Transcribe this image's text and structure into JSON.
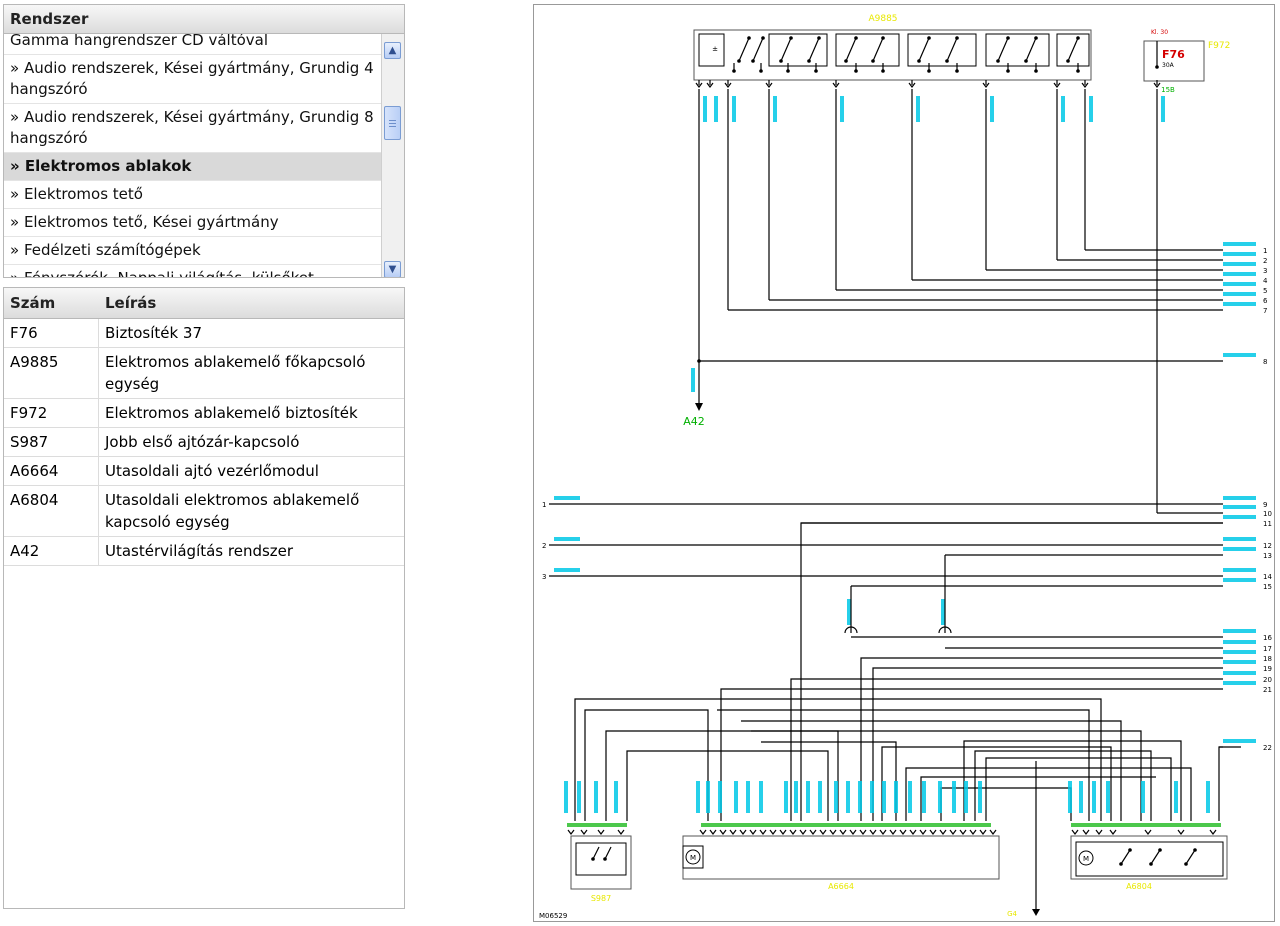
{
  "system_panel": {
    "header": "Rendszer",
    "items": [
      {
        "label": "Gamma hangrendszer CD váltóval",
        "active": false
      },
      {
        "label": "» Audio rendszerek, Kései gyártmány, Grundig 4 hangszóró",
        "active": false
      },
      {
        "label": "» Audio rendszerek, Kései gyártmány, Grundig 8 hangszóró",
        "active": false
      },
      {
        "label": "» Elektromos ablakok",
        "active": true
      },
      {
        "label": "» Elektromos tető",
        "active": false
      },
      {
        "label": "» Elektromos tető, Kései gyártmány",
        "active": false
      },
      {
        "label": "» Fedélzeti számítógépek",
        "active": false
      },
      {
        "label": "» Fényszórók, Nappali világítás, külsőket",
        "active": false
      }
    ]
  },
  "component_table": {
    "columns": [
      "Szám",
      "Leírás"
    ],
    "rows": [
      {
        "num": "F76",
        "desc": "Biztosíték 37"
      },
      {
        "num": "A9885",
        "desc": "Elektromos ablakemelő főkapcsoló egység"
      },
      {
        "num": "F972",
        "desc": "Elektromos ablakemelő biztosíték"
      },
      {
        "num": "S987",
        "desc": "Jobb első ajtózár-kapcsoló"
      },
      {
        "num": "A6664",
        "desc": "Utasoldali ajtó vezérlőmodul"
      },
      {
        "num": "A6804",
        "desc": "Utasoldali elektromos ablakemelő kapcsoló egység"
      },
      {
        "num": "A42",
        "desc": "Utastérvilágítás rendszer"
      }
    ]
  },
  "diagram": {
    "top_component_label": "A9885",
    "fuse_block_label": "F972",
    "fuse_terminal": "Kl. 30",
    "fuse_id": "F76",
    "fuse_rating": "30A",
    "fuse_pin_label": "15B",
    "ground_label": "A42",
    "bottom_left_label": "S987",
    "bottom_mid_label": "A6664",
    "bottom_right_label": "A6804",
    "bottom_ground_label": "G4",
    "figure_id": "M06529",
    "colors": {
      "wire": "#000000",
      "cyan_label": "#00c8e6",
      "yellow_label": "#e8e800",
      "red_label": "#d40000",
      "green_label": "#00b000"
    },
    "right_connector_numbers": [
      "1",
      "2",
      "3",
      "4",
      "5",
      "6",
      "7",
      "8",
      "9",
      "10",
      "11",
      "12",
      "13",
      "14",
      "15",
      "16",
      "17",
      "18",
      "19",
      "20",
      "21",
      "22"
    ],
    "left_connector_numbers": [
      "1",
      "2",
      "3"
    ]
  }
}
